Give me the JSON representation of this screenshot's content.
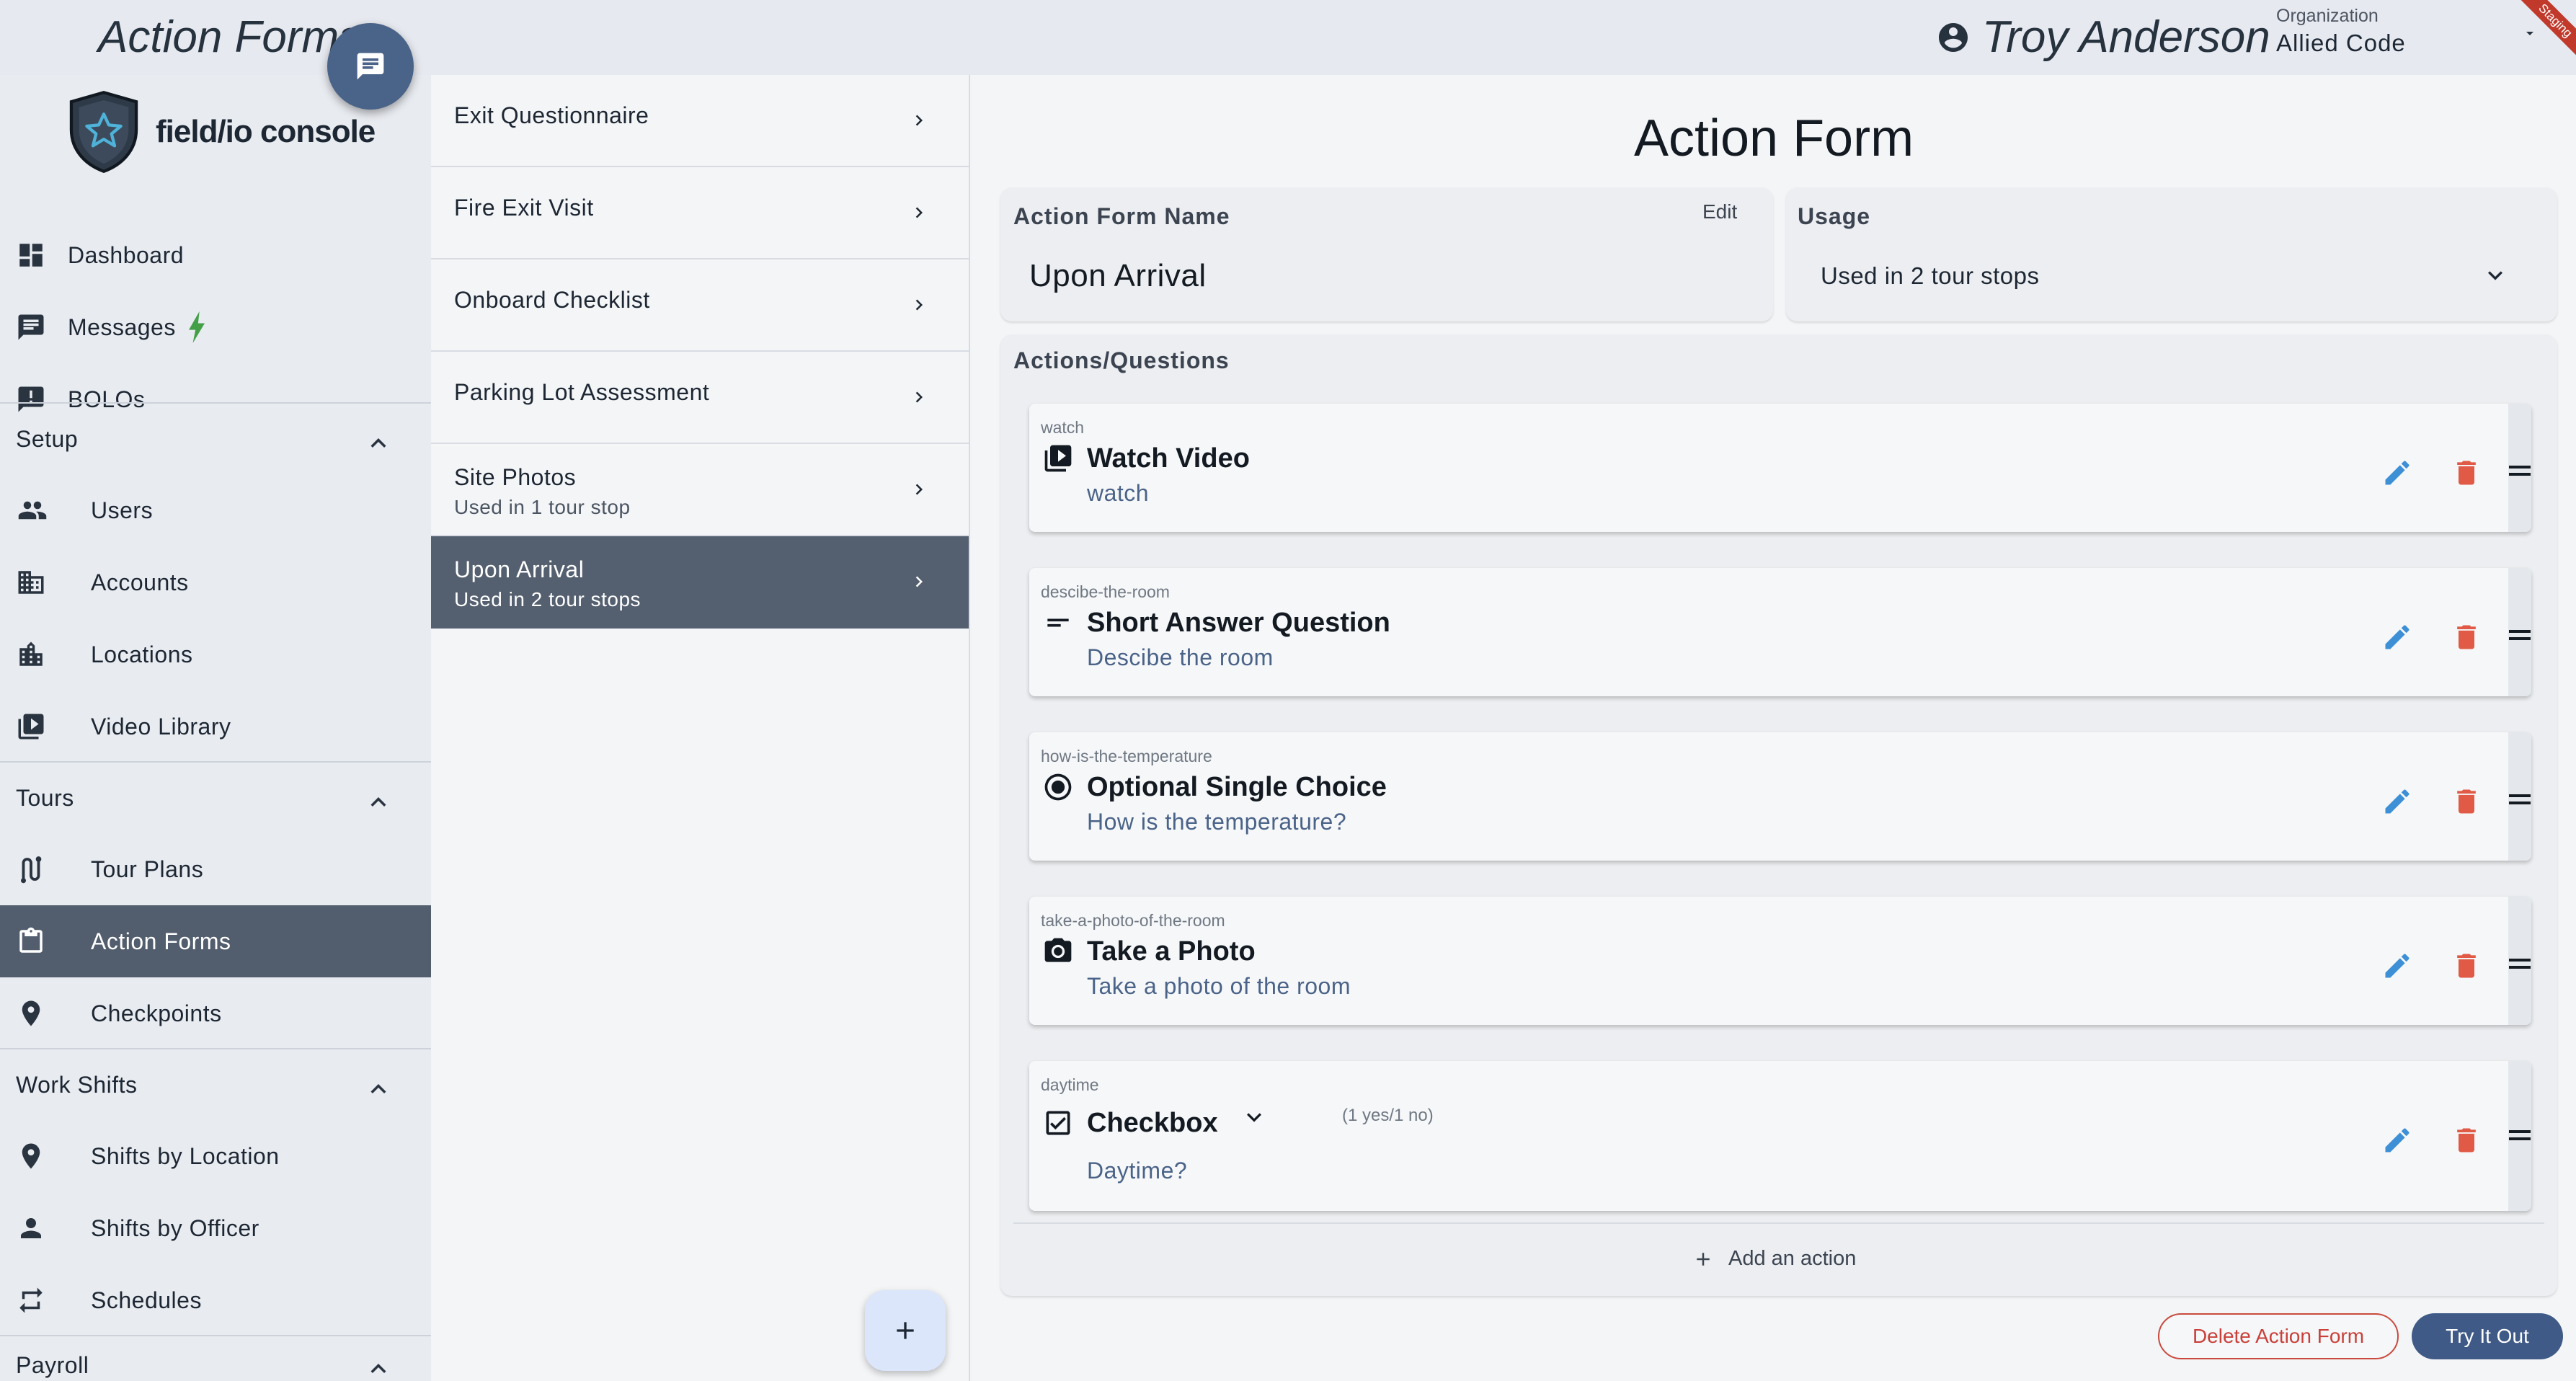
{
  "header": {
    "app_title": "Action Forms",
    "user_name": "Troy Anderson",
    "org_label": "Organization",
    "org_value": "Allied Code",
    "env_badge": "Staging"
  },
  "sidebar": {
    "brand": "field/io console",
    "top_items": [
      {
        "label": "Dashboard",
        "icon": "dashboard-icon"
      },
      {
        "label": "Messages",
        "icon": "message-icon",
        "badge_icon": "bolt-icon"
      },
      {
        "label": "BOLOs",
        "icon": "report-icon"
      }
    ],
    "sections": [
      {
        "label": "Setup",
        "items": [
          {
            "label": "Users",
            "icon": "users-icon"
          },
          {
            "label": "Accounts",
            "icon": "building-icon"
          },
          {
            "label": "Locations",
            "icon": "city-icon"
          },
          {
            "label": "Video Library",
            "icon": "video-library-icon"
          }
        ]
      },
      {
        "label": "Tours",
        "items": [
          {
            "label": "Tour Plans",
            "icon": "route-icon"
          },
          {
            "label": "Action Forms",
            "icon": "clipboard-icon",
            "active": true
          },
          {
            "label": "Checkpoints",
            "icon": "pin-icon"
          }
        ]
      },
      {
        "label": "Work Shifts",
        "items": [
          {
            "label": "Shifts by Location",
            "icon": "pin-icon"
          },
          {
            "label": "Shifts by Officer",
            "icon": "person-icon"
          },
          {
            "label": "Schedules",
            "icon": "repeat-icon"
          }
        ]
      },
      {
        "label": "Payroll",
        "items": []
      }
    ]
  },
  "form_list": {
    "items": [
      {
        "title": "Exit Questionnaire",
        "subtitle": ""
      },
      {
        "title": "Fire Exit Visit",
        "subtitle": ""
      },
      {
        "title": "Onboard Checklist",
        "subtitle": ""
      },
      {
        "title": "Parking Lot Assessment",
        "subtitle": ""
      },
      {
        "title": "Site Photos",
        "subtitle": "Used in 1 tour stop"
      },
      {
        "title": "Upon Arrival",
        "subtitle": "Used in 2 tour stops",
        "active": true
      }
    ]
  },
  "main": {
    "page_title": "Action Form",
    "name_label": "Action Form Name",
    "edit_label": "Edit",
    "name_value": "Upon Arrival",
    "usage_label": "Usage",
    "usage_value": "Used in 2 tour stops",
    "actions_label": "Actions/Questions",
    "actions": [
      {
        "slug": "watch",
        "title": "Watch Video",
        "desc": "watch",
        "icon": "video-icon"
      },
      {
        "slug": "descibe-the-room",
        "title": "Short Answer Question",
        "desc": "Descibe the room",
        "icon": "short-text-icon"
      },
      {
        "slug": "how-is-the-temperature",
        "title": "Optional Single Choice",
        "desc": "How is the temperature?",
        "icon": "radio-icon"
      },
      {
        "slug": "take-a-photo-of-the-room",
        "title": "Take a Photo",
        "desc": "Take a photo of the room",
        "icon": "camera-icon"
      },
      {
        "slug": "daytime",
        "title": "Checkbox",
        "desc": "Daytime?",
        "icon": "checkbox-icon",
        "extra": "(1 yes/1 no)"
      }
    ],
    "add_action_label": "Add an action",
    "delete_label": "Delete Action Form",
    "try_label": "Try It Out"
  },
  "colors": {
    "accent": "#4a6388",
    "active_row": "#545f6f",
    "pencil": "#3d8fd6",
    "trash": "#e05a45",
    "bolt": "#43a047"
  }
}
